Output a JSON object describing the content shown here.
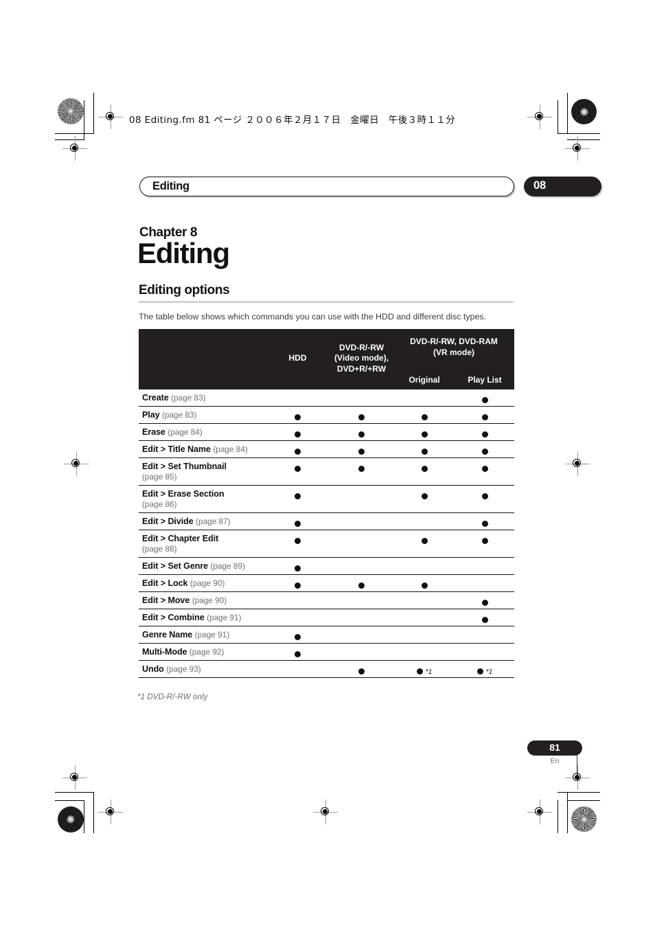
{
  "print_marks": {
    "fm_header": "08 Editing.fm 81 ページ  ２００６年２月１７日　金曜日　午後３時１１分"
  },
  "running_head": {
    "label": "Editing",
    "chapter_number": "08"
  },
  "chapter": {
    "eyebrow": "Chapter 8",
    "title": "Editing"
  },
  "section": {
    "heading": "Editing options",
    "intro": "The table below shows which commands you can use with the HDD and different disc types."
  },
  "table": {
    "headers": {
      "command_col": "",
      "hdd": "HDD",
      "video_mode": "DVD-R/-RW\n(Video mode),\nDVD+R/+RW",
      "video_mode_line1": "DVD-R/-RW",
      "video_mode_line2": "(Video mode),",
      "video_mode_line3": "DVD+R/+RW",
      "vr_mode_line1": "DVD-R/-RW, DVD-RAM",
      "vr_mode_line2": "(VR mode)",
      "original": "Original",
      "play_list": "Play List"
    },
    "rows": [
      {
        "name": "Create",
        "page": "(page 83)",
        "page_on_second_line": false,
        "hdd": "",
        "video": "",
        "original": "",
        "playlist": "dot"
      },
      {
        "name": "Play",
        "page": "(page 83)",
        "page_on_second_line": false,
        "hdd": "dot",
        "video": "dot",
        "original": "dot",
        "playlist": "dot"
      },
      {
        "name": "Erase",
        "page": "(page 84)",
        "page_on_second_line": false,
        "hdd": "dot",
        "video": "dot",
        "original": "dot",
        "playlist": "dot"
      },
      {
        "name": "Edit > Title Name",
        "page": "(page 84)",
        "page_on_second_line": false,
        "hdd": "dot",
        "video": "dot",
        "original": "dot",
        "playlist": "dot"
      },
      {
        "name": "Edit > Set Thumbnail",
        "page": "(page 85)",
        "page_on_second_line": true,
        "hdd": "dot",
        "video": "dot",
        "original": "dot",
        "playlist": "dot"
      },
      {
        "name": "Edit > Erase Section",
        "page": "(page 86)",
        "page_on_second_line": true,
        "hdd": "dot",
        "video": "",
        "original": "dot",
        "playlist": "dot"
      },
      {
        "name": "Edit > Divide",
        "page": "(page 87)",
        "page_on_second_line": false,
        "hdd": "dot",
        "video": "",
        "original": "",
        "playlist": "dot"
      },
      {
        "name": "Edit > Chapter Edit",
        "page": "(page 88)",
        "page_on_second_line": true,
        "hdd": "dot",
        "video": "",
        "original": "dot",
        "playlist": "dot"
      },
      {
        "name": "Edit > Set Genre",
        "page": "(page 89)",
        "page_on_second_line": false,
        "hdd": "dot",
        "video": "",
        "original": "",
        "playlist": ""
      },
      {
        "name": "Edit > Lock",
        "page": "(page 90)",
        "page_on_second_line": false,
        "hdd": "dot",
        "video": "dot",
        "original": "dot",
        "playlist": ""
      },
      {
        "name": "Edit > Move",
        "page": "(page 90)",
        "page_on_second_line": false,
        "hdd": "",
        "video": "",
        "original": "",
        "playlist": "dot"
      },
      {
        "name": "Edit > Combine",
        "page": "(page 91)",
        "page_on_second_line": false,
        "hdd": "",
        "video": "",
        "original": "",
        "playlist": "dot"
      },
      {
        "name": "Genre Name",
        "page": "(page 91)",
        "page_on_second_line": false,
        "hdd": "dot",
        "video": "",
        "original": "",
        "playlist": ""
      },
      {
        "name": "Multi-Mode",
        "page": "(page 92)",
        "page_on_second_line": false,
        "hdd": "dot",
        "video": "",
        "original": "",
        "playlist": ""
      },
      {
        "name": "Undo",
        "page": "(page 93)",
        "page_on_second_line": false,
        "hdd": "",
        "video": "dot",
        "original": "dot*1",
        "playlist": "dot*1"
      }
    ]
  },
  "footnote": {
    "marker": "*1",
    "text": "*1  DVD-R/-RW only"
  },
  "footer": {
    "page_number": "81",
    "language": "En"
  },
  "colors": {
    "header_black": "#231f20",
    "rule_gray": "#d2d2d2",
    "body_gray": "#3b3b3b",
    "page_ref_gray": "#6f6f6f"
  }
}
